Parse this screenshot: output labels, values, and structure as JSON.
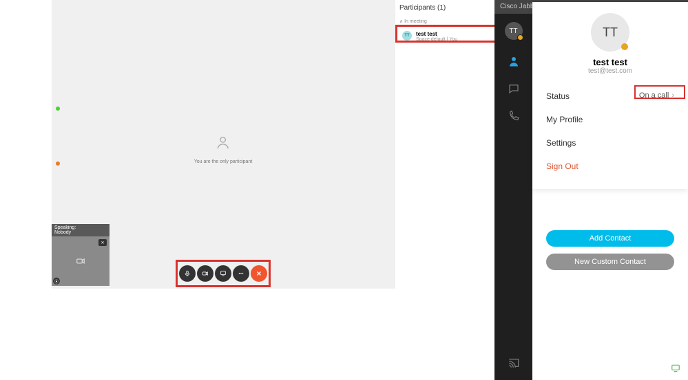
{
  "meeting": {
    "only_participant_text": "You are the only participant",
    "speaking_label": "Speaking:",
    "speaking_name": "Nobody",
    "participants_title": "Participants (1)",
    "in_meeting_label": "In meeting",
    "participant": {
      "initials": "TT",
      "name": "test test",
      "info": "Space default | You"
    },
    "close_label": "X"
  },
  "jabber": {
    "title": "Cisco Jabber",
    "avatar_initials": "TT",
    "popover": {
      "initials": "TT",
      "name": "test test",
      "email": "test@test.com",
      "status_label": "Status",
      "status_value": "On a call",
      "my_profile": "My Profile",
      "settings": "Settings",
      "sign_out": "Sign Out"
    },
    "add_contact": "Add Contact",
    "new_custom_contact": "New Custom Contact"
  }
}
